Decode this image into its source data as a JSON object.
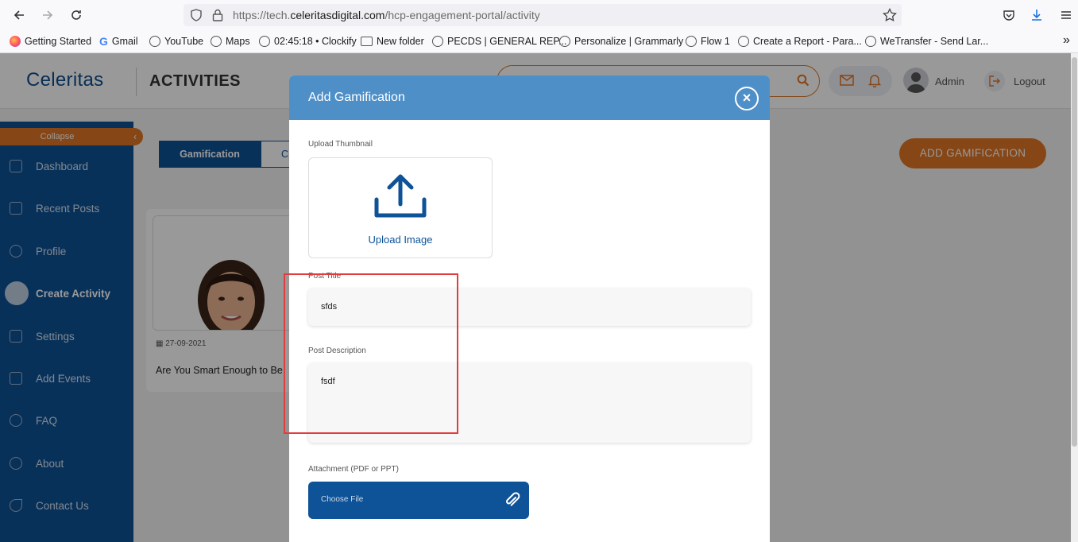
{
  "browser": {
    "url_prefix": "https://tech.",
    "url_domain": "celeritasdigital.com",
    "url_path": "/hcp-engagement-portal/activity",
    "bookmarks": [
      {
        "label": "Getting Started",
        "icon": "firefox-icon"
      },
      {
        "label": "Gmail",
        "icon": "google-icon"
      },
      {
        "label": "YouTube",
        "icon": "globe-icon"
      },
      {
        "label": "Maps",
        "icon": "globe-icon"
      },
      {
        "label": "02:45:18 • Clockify",
        "icon": "globe-icon"
      },
      {
        "label": "New folder",
        "icon": "folder-icon"
      },
      {
        "label": "PECDS | GENERAL REP...",
        "icon": "globe-icon"
      },
      {
        "label": "Personalize | Grammarly",
        "icon": "globe-icon"
      },
      {
        "label": "Flow 1",
        "icon": "globe-icon"
      },
      {
        "label": "Create a Report - Para...",
        "icon": "globe-icon"
      },
      {
        "label": "WeTransfer - Send Lar...",
        "icon": "globe-icon"
      }
    ]
  },
  "header": {
    "logo": "Celeritas",
    "title": "ACTIVITIES",
    "user": "Admin",
    "logout": "Logout"
  },
  "sidebar": {
    "collapse": "Collapse",
    "items": [
      {
        "label": "Dashboard"
      },
      {
        "label": "Recent Posts"
      },
      {
        "label": "Profile"
      },
      {
        "label": "Create Activity",
        "active": true
      },
      {
        "label": "Settings"
      },
      {
        "label": "Add Events"
      },
      {
        "label": "FAQ"
      },
      {
        "label": "About"
      },
      {
        "label": "Contact Us"
      }
    ]
  },
  "main": {
    "tab_active": "Gamification",
    "tab_other": "C",
    "add_button": "ADD GAMIFICATION",
    "card": {
      "date": "27-09-2021",
      "title": "Are You Smart Enough to Be"
    }
  },
  "modal": {
    "title": "Add Gamification",
    "upload_label": "Upload Thumbnail",
    "upload_text": "Upload Image",
    "post_title_label": "Post Title",
    "post_title_value": "sfds",
    "post_desc_label": "Post Description",
    "post_desc_value": "fsdf",
    "attachment_label": "Attachment (PDF or PPT)",
    "choose_file": "Choose File"
  },
  "colors": {
    "primary": "#0e5297",
    "accent": "#e07626",
    "modal_header": "#4f8fc8",
    "highlight": "#e23c3c"
  }
}
